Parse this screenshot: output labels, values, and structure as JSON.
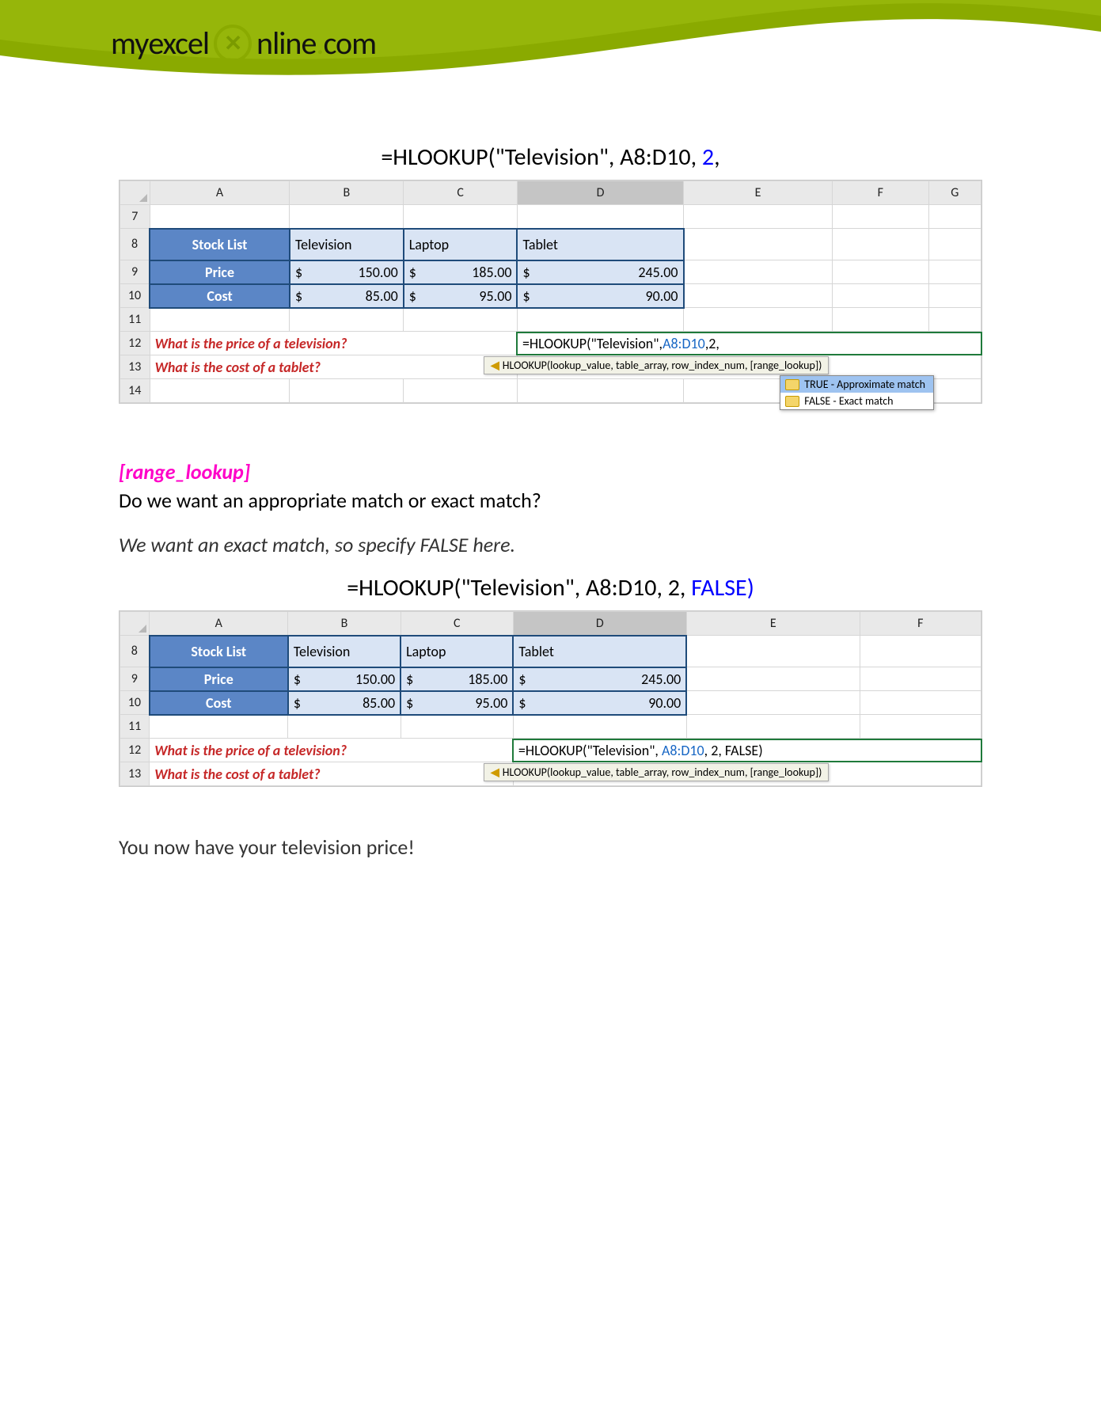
{
  "header": {
    "logo_my": "my",
    "logo_excel": "excel",
    "logo_nline": "nline",
    "logo_dot": ".",
    "logo_com": "com",
    "x": "✕"
  },
  "formula1": {
    "prefix": "=HLOOKUP(\"Television\", A8:D10, ",
    "arg": "2",
    "suffix": ","
  },
  "sheet1": {
    "cols": [
      "A",
      "B",
      "C",
      "D",
      "E",
      "F",
      "G"
    ],
    "rows": [
      "7",
      "8",
      "9",
      "10",
      "11",
      "12",
      "13",
      "14"
    ],
    "labels": {
      "stock": "Stock List",
      "price": "Price",
      "cost": "Cost"
    },
    "hdrs": {
      "tv": "Television",
      "laptop": "Laptop",
      "tablet": "Tablet"
    },
    "prices": {
      "tv": "150.00",
      "laptop": "185.00",
      "tablet": "245.00"
    },
    "costs": {
      "tv": "85.00",
      "laptop": "95.00",
      "tablet": "90.00"
    },
    "q1": "What is the price of a television?",
    "q2": "What is the cost of a tablet?",
    "formula_prefix": "=HLOOKUP(\"Television\",",
    "formula_range": "A8:D10",
    "formula_suffix": ",2,",
    "syntax": "HLOOKUP(lookup_value, table_array, row_index_num, [range_lookup])",
    "auto1": "TRUE - Approximate match",
    "auto2": "FALSE - Exact match"
  },
  "section": {
    "label": "[range_lookup]",
    "question": "Do we want an appropriate match or exact match?",
    "answer": "We want an exact match, so specify FALSE here."
  },
  "formula2": {
    "prefix": "=HLOOKUP(\"Television\", A8:D10, 2, ",
    "arg": "FALSE)",
    "suffix": ""
  },
  "sheet2": {
    "cols": [
      "A",
      "B",
      "C",
      "D",
      "E",
      "F"
    ],
    "rows": [
      "8",
      "9",
      "10",
      "11",
      "12",
      "13"
    ],
    "formula_prefix": "=HLOOKUP(\"Television\", ",
    "formula_range": "A8:D10",
    "formula_suffix": ", 2, FALSE)",
    "syntax": "HLOOKUP(lookup_value, table_array, row_index_num, [range_lookup])"
  },
  "result": "You now have your television price!"
}
